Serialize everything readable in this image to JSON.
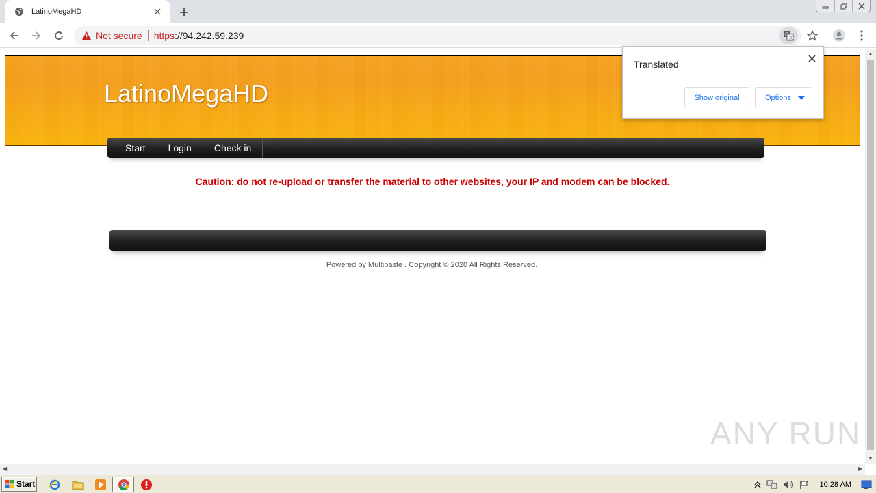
{
  "browser": {
    "tab_title": "LatinoMegaHD",
    "not_secure_label": "Not secure",
    "url_scheme": "https",
    "url_rest": "://94.242.59.239"
  },
  "page": {
    "site_title": "LatinoMegaHD",
    "nav": [
      "Start",
      "Login",
      "Check in"
    ],
    "caution": "Caution: do not re-upload or transfer the material to other websites, your IP and modem can be blocked.",
    "copyright": "Powered by Multipaste . Copyright © 2020 All Rights Reserved."
  },
  "translate_popup": {
    "title": "Translated",
    "show_original": "Show original",
    "options": "Options"
  },
  "watermark": "ANY RUN",
  "taskbar": {
    "start_label": "Start",
    "clock": "10:28 AM"
  },
  "colors": {
    "header_orange": "#f7a21e",
    "caution_red": "#cc0000",
    "not_secure_red": "#c5221f"
  }
}
